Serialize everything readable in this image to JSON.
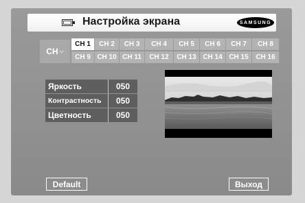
{
  "header": {
    "title": "Настройка экрана",
    "icon": "monitor-icon",
    "brand": "SAMSUNG"
  },
  "channels": {
    "label": "CH",
    "selected": "CH 1",
    "row1": [
      "CH 1",
      "CH 2",
      "CH 3",
      "CH 4",
      "CH 5",
      "CH 6",
      "CH 7",
      "CH 8"
    ],
    "row2": [
      "CH 9",
      "CH 10",
      "CH 11",
      "CH 12",
      "CH 13",
      "CH 14",
      "CH 15",
      "CH 16"
    ]
  },
  "settings": [
    {
      "label": "Яркость",
      "value": "050"
    },
    {
      "label": "Контрастность",
      "value": "050"
    },
    {
      "label": "Цветность",
      "value": "050"
    }
  ],
  "buttons": {
    "default": "Default",
    "exit": "Выход"
  },
  "colors": {
    "panel": "#8f8f8f",
    "selected_channel": "#ffffff",
    "setting_row": "#5e5e5e"
  }
}
